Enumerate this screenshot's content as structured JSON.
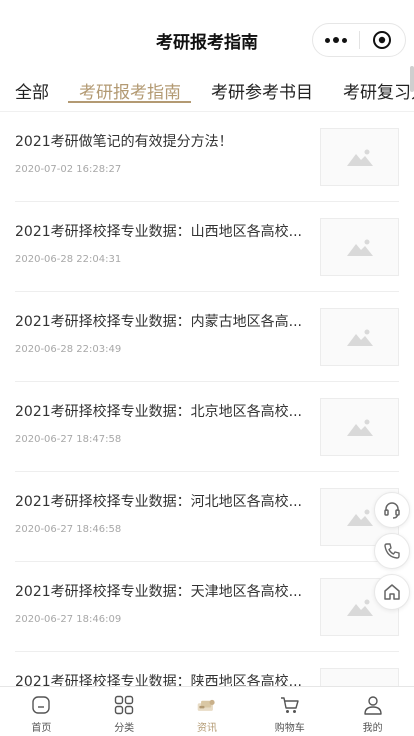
{
  "nav": {
    "title": "考研报考指南"
  },
  "tabs": [
    {
      "label": "全部"
    },
    {
      "label": "考研报考指南"
    },
    {
      "label": "考研参考书目"
    },
    {
      "label": "考研复习方法"
    }
  ],
  "articles": [
    {
      "title": "2021考研做笔记的有效提分方法！",
      "time": "2020-07-02 16:28:27"
    },
    {
      "title": "2021考研择校择专业数据：山西地区各高校...",
      "time": "2020-06-28 22:04:31"
    },
    {
      "title": "2021考研择校择专业数据：内蒙古地区各高...",
      "time": "2020-06-28 22:03:49"
    },
    {
      "title": "2021考研择校择专业数据：北京地区各高校...",
      "time": "2020-06-27 18:47:58"
    },
    {
      "title": "2021考研择校择专业数据：河北地区各高校...",
      "time": "2020-06-27 18:46:58"
    },
    {
      "title": "2021考研择校择专业数据：天津地区各高校...",
      "time": "2020-06-27 18:46:09"
    },
    {
      "title": "2021考研择校择专业数据：陕西地区各高校...",
      "time": ""
    }
  ],
  "tabbar": [
    {
      "label": "首页",
      "icon": "home-icon"
    },
    {
      "label": "分类",
      "icon": "grid-icon"
    },
    {
      "label": "资讯",
      "icon": "news-icon"
    },
    {
      "label": "购物车",
      "icon": "cart-icon"
    },
    {
      "label": "我的",
      "icon": "user-icon"
    }
  ],
  "colors": {
    "accent": "#b39a73",
    "text": "#333333",
    "muted": "#a8a8a8"
  }
}
